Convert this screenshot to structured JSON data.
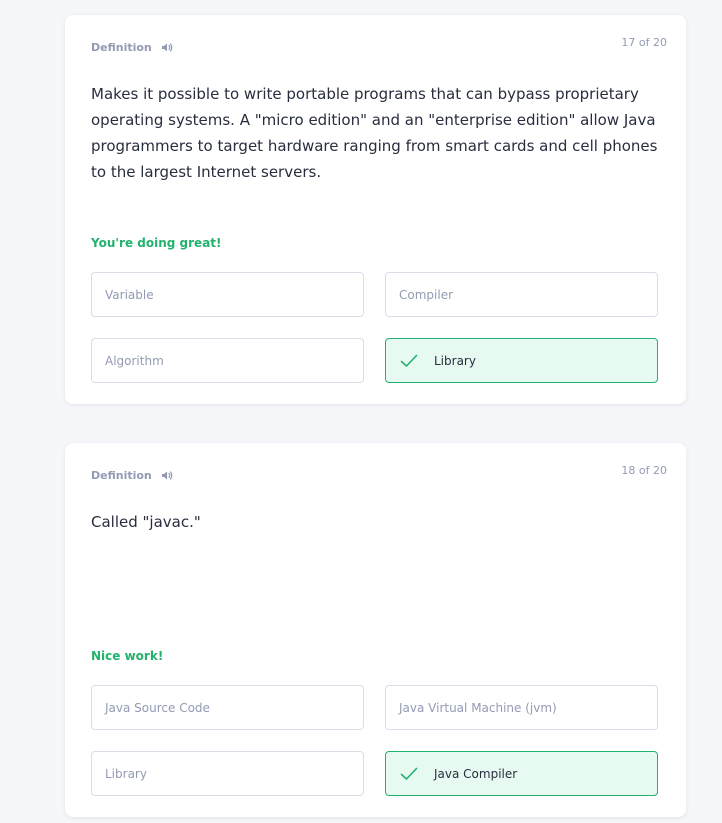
{
  "cards": [
    {
      "label": "Definition",
      "counter": "17 of 20",
      "definition": "Makes it possible to write portable programs that can bypass proprietary operating systems. A \"micro edition\" and an \"enterprise edition\" allow Java programmers to target hardware ranging from smart cards and cell phones to the largest Internet servers.",
      "feedback": "You're doing great!",
      "options": [
        "Variable",
        "Compiler",
        "Algorithm",
        "Library"
      ],
      "correct_option": "Library"
    },
    {
      "label": "Definition",
      "counter": "18 of 20",
      "definition": "Called \"javac.\"",
      "feedback": "Nice work!",
      "options": [
        "Java Source Code",
        "Java Virtual Machine (jvm)",
        "Library",
        "Java Compiler"
      ],
      "correct_option": "Java Compiler"
    }
  ],
  "icons": {
    "audio": "speaker-icon",
    "correct": "checkmark-icon"
  },
  "colors": {
    "page_background": "#f6f7fb",
    "card_background": "#ffffff",
    "muted_text": "#939bb4",
    "body_text": "#282e3e",
    "success_green": "#23b26d",
    "correct_background": "#e6faf2",
    "option_border": "#d9dde8"
  }
}
